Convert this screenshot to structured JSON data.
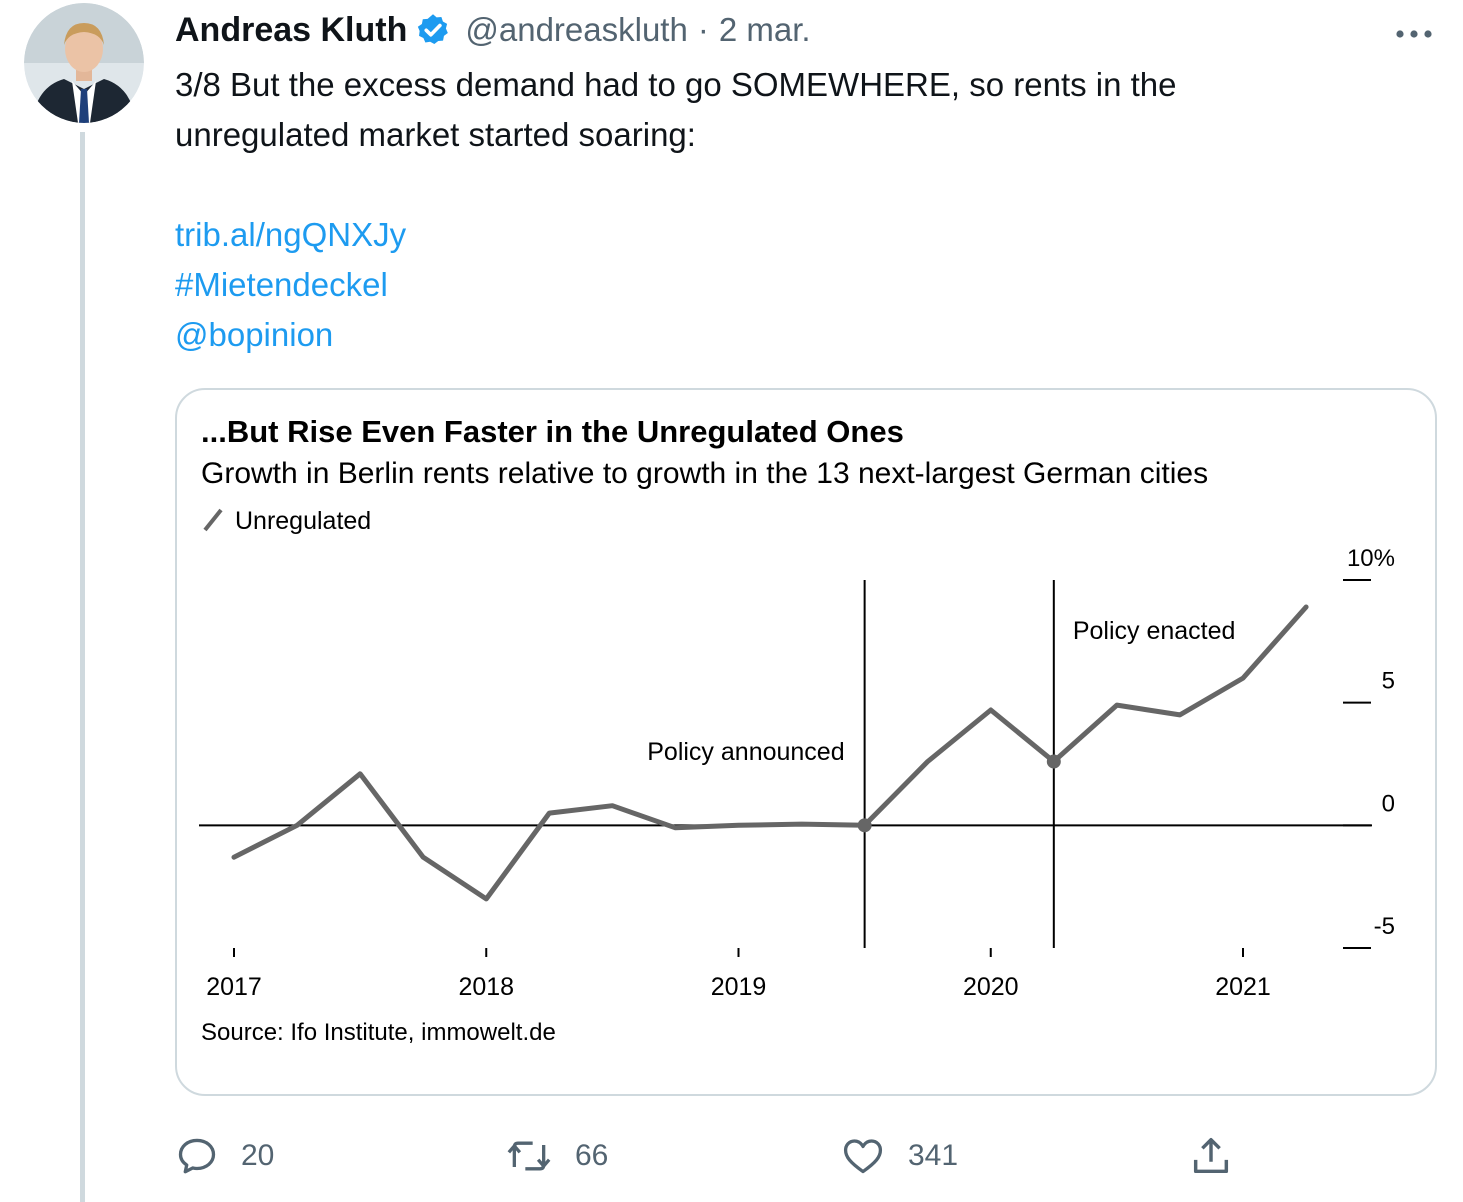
{
  "tweet": {
    "author_name": "Andreas Kluth",
    "handle": "@andreaskluth",
    "separator": "·",
    "date": "2 mar.",
    "text_line1": "3/8 But the excess demand had to go SOMEWHERE, so rents in the",
    "text_line2": "unregulated market started soaring:",
    "link": "trib.al/ngQNXJy",
    "hashtag": "#Mietendeckel",
    "mention": "@bopinion",
    "verified": true,
    "icons": {
      "avatar": "author-photo",
      "verified": "verified-badge-icon",
      "more": "more-dots-icon",
      "reply": "reply-icon",
      "retweet": "retweet-icon",
      "like": "heart-icon",
      "share": "share-icon"
    },
    "colors": {
      "link": "#1d9bf0",
      "muted": "#536471",
      "verified": "#1d9bf0"
    }
  },
  "actions": {
    "replies": "20",
    "retweets": "66",
    "likes": "341"
  },
  "chart_data": {
    "type": "line",
    "title": "...But Rise Even Faster in the Unregulated Ones",
    "subtitle": "Growth in Berlin rents relative to growth in the 13 next-largest German cities",
    "legend": [
      "Unregulated"
    ],
    "legend_position": "top-left",
    "y_axis_position": "right",
    "ylim": [
      -5,
      10
    ],
    "yticks": [
      "10%",
      "5",
      "0",
      "-5"
    ],
    "ytick_values": [
      10,
      5,
      0,
      -5
    ],
    "xticks": [
      "2017",
      "2018",
      "2019",
      "2020",
      "2021"
    ],
    "xtick_values": [
      2017.0,
      2018.0,
      2019.0,
      2020.0,
      2021.0
    ],
    "xlim": [
      2016.75,
      2021.5
    ],
    "grid": false,
    "zero_line": true,
    "series": [
      {
        "name": "Unregulated",
        "color": "#666666",
        "x": [
          2017.0,
          2017.25,
          2017.5,
          2017.75,
          2018.0,
          2018.25,
          2018.5,
          2018.75,
          2019.0,
          2019.25,
          2019.5,
          2019.75,
          2020.0,
          2020.25,
          2020.5,
          2020.75,
          2021.0,
          2021.25
        ],
        "y": [
          -1.3,
          0.0,
          2.1,
          -1.3,
          -3.0,
          0.5,
          0.8,
          -0.1,
          0.0,
          0.05,
          0.0,
          2.6,
          4.7,
          2.6,
          4.9,
          4.5,
          6.0,
          8.9
        ]
      }
    ],
    "annotations": [
      {
        "label": "Policy announced",
        "x": 2019.5,
        "y": 0.0
      },
      {
        "label": "Policy enacted",
        "x": 2020.25,
        "y": 2.6
      }
    ],
    "source": "Source: Ifo Institute, immowelt.de"
  }
}
